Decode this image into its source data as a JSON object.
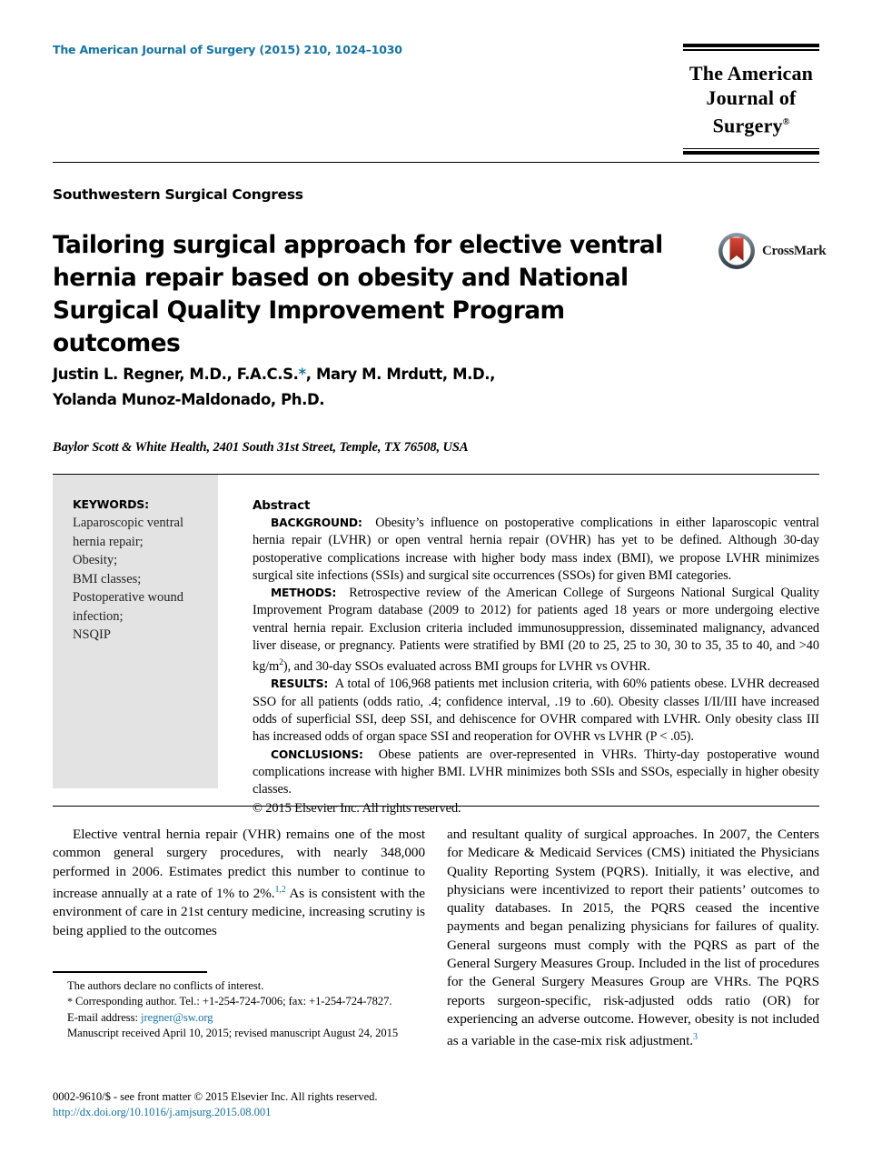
{
  "header": {
    "journal_citation": "The American Journal of Surgery (2015) 210, 1024–1030",
    "masthead_line1": "The American",
    "masthead_line2": "Journal of Surgery",
    "masthead_registered": "®"
  },
  "article": {
    "society": "Southwestern Surgical Congress",
    "title": "Tailoring surgical approach for elective ventral hernia repair based on obesity and National Surgical Quality Improvement Program outcomes",
    "authors_line1_a": "Justin L. Regner, M.D., F.A.C.S.",
    "authors_star": "*",
    "authors_line1_b": ", Mary M. Mrdutt, M.D.,",
    "authors_line2": "Yolanda Munoz-Maldonado, Ph.D.",
    "affiliation": "Baylor Scott & White Health, 2401 South 31st Street, Temple, TX 76508, USA",
    "crossmark_label": "CrossMark"
  },
  "keywords": {
    "heading": "KEYWORDS:",
    "items": [
      "Laparoscopic ventral hernia repair;",
      "Obesity;",
      "BMI classes;",
      "Postoperative wound infection;",
      "NSQIP"
    ]
  },
  "abstract": {
    "heading": "Abstract",
    "background_label": "BACKGROUND:",
    "background_text": "Obesity’s influence on postoperative complications in either laparoscopic ventral hernia repair (LVHR) or open ventral hernia repair (OVHR) has yet to be defined. Although 30-day postoperative complications increase with higher body mass index (BMI), we propose LVHR minimizes surgical site infections (SSIs) and surgical site occurrences (SSOs) for given BMI categories.",
    "methods_label": "METHODS:",
    "methods_text_a": "Retrospective review of the American College of Surgeons National Surgical Quality Improvement Program database (2009 to 2012) for patients aged 18 years or more undergoing elective ventral hernia repair. Exclusion criteria included immunosuppression, disseminated malignancy, advanced liver disease, or pregnancy. Patients were stratified by BMI (20 to 25, 25 to 30, 30 to 35, 35 to 40, and >40 kg/m",
    "methods_sup": "2",
    "methods_text_b": "), and 30-day SSOs evaluated across BMI groups for LVHR vs OVHR.",
    "results_label": "RESULTS:",
    "results_text": "A total of 106,968 patients met inclusion criteria, with 60% patients obese. LVHR decreased SSO for all patients (odds ratio, .4; confidence interval, .19 to .60). Obesity classes I/II/III have increased odds of superficial SSI, deep SSI, and dehiscence for OVHR compared with LVHR. Only obesity class III has increased odds of organ space SSI and reoperation for OVHR vs LVHR (P < .05).",
    "conclusions_label": "CONCLUSIONS:",
    "conclusions_text": "Obese patients are over-represented in VHRs. Thirty-day postoperative wound complications increase with higher BMI. LVHR minimizes both SSIs and SSOs, especially in higher obesity classes.",
    "copyright": "© 2015 Elsevier Inc. All rights reserved."
  },
  "body": {
    "left_paragraph_a": "Elective ventral hernia repair (VHR) remains one of the most common general surgery procedures, with nearly 348,000 performed in 2006. Estimates predict this number to continue to increase annually at a rate of 1% to 2%.",
    "left_ref_1": "1,2",
    "left_paragraph_b": " As is consistent with the environment of care in 21st century medicine, increasing scrutiny is being applied to the outcomes",
    "right_paragraph_a": "and resultant quality of surgical approaches. In 2007, the Centers for Medicare & Medicaid Services (CMS) initiated the Physicians Quality Reporting System (PQRS). Initially, it was elective, and physicians were incentivized to report their patients’ outcomes to quality databases. In 2015, the PQRS ceased the incentive payments and began penalizing physicians for failures of quality. General surgeons must comply with the PQRS as part of the General Surgery Measures Group. Included in the list of procedures for the General Surgery Measures Group are VHRs. The PQRS reports surgeon-specific, risk-adjusted odds ratio (OR) for experiencing an adverse outcome. However, obesity is not included as a variable in the case-mix risk adjustment.",
    "right_ref_3": "3"
  },
  "footnotes": {
    "conflicts": "The authors declare no conflicts of interest.",
    "corresponding_star": "*",
    "corresponding": " Corresponding author. Tel.: +1-254-724-7006; fax: +1-254-724-7827.",
    "email_label": "E-mail address: ",
    "email_value": "jregner@sw.org",
    "manuscript": "Manuscript received April 10, 2015; revised manuscript August 24, 2015"
  },
  "footer": {
    "issn_line": "0002-9610/$ - see front matter © 2015 Elsevier Inc. All rights reserved.",
    "doi": "http://dx.doi.org/10.1016/j.amjsurg.2015.08.001"
  },
  "colors": {
    "link": "#1573a5",
    "keywords_bg": "#e3e3e3",
    "crossmark_red": "#c0392b"
  }
}
